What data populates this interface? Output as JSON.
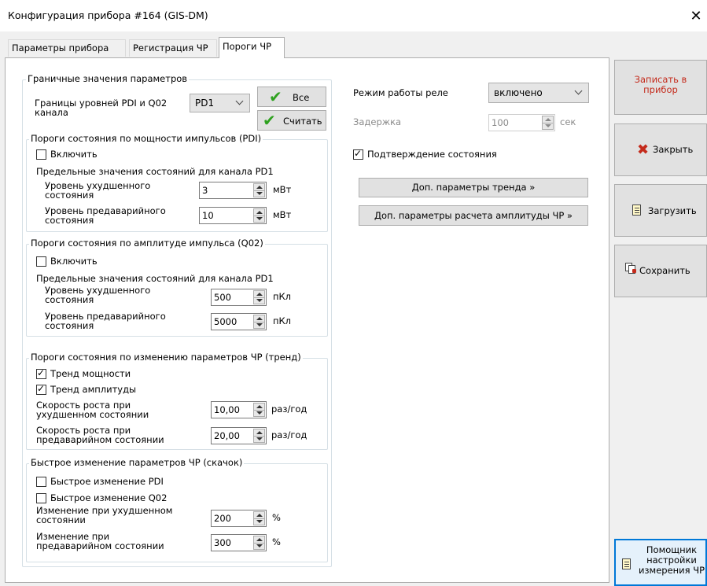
{
  "window": {
    "title": "Конфигурация прибора #164 (GIS-DM)"
  },
  "tabs": [
    {
      "label": "Параметры прибора"
    },
    {
      "label": "Регистрация ЧР"
    },
    {
      "label": "Пороги ЧР"
    }
  ],
  "limits": {
    "title": "Граничные значения параметров",
    "channel_label": "Границы уровней PDI и Q02 канала",
    "channel_value": "PD1",
    "all_button": "Все",
    "read_button": "Считать"
  },
  "pdi": {
    "title": "Пороги состояния по мощности импульсов (PDI)",
    "enable_label": "Включить",
    "enabled": false,
    "subtitle": "Предельные значения состояний для канала PD1",
    "rows": [
      {
        "label": "Уровень ухудшенного\nсостояния",
        "value": "3",
        "unit": "мВт"
      },
      {
        "label": "Уровень предаварийного\nсостояния",
        "value": "10",
        "unit": "мВт"
      }
    ]
  },
  "q02": {
    "title": "Пороги состояния по амплитуде импульса (Q02)",
    "enable_label": "Включить",
    "enabled": false,
    "subtitle": "Предельные значения состояний для канала PD1",
    "rows": [
      {
        "label": "Уровень ухудшенного\nсостояния",
        "value": "500",
        "unit": "пКл"
      },
      {
        "label": "Уровень предаварийного\nсостояния",
        "value": "5000",
        "unit": "пКл"
      }
    ]
  },
  "trend": {
    "title": "Пороги состояния по изменению параметров ЧР (тренд)",
    "power_label": "Тренд мощности",
    "power_checked": true,
    "amplitude_label": "Тренд амплитуды",
    "amplitude_checked": true,
    "rows": [
      {
        "label": "Скорость роста при\nухудшенном состоянии",
        "value": "10,00",
        "unit": "раз/год"
      },
      {
        "label": "Скорость роста при\nпредаварийном состоянии",
        "value": "20,00",
        "unit": "раз/год"
      }
    ]
  },
  "jump": {
    "title": "Быстрое изменение параметров ЧР (скачок)",
    "pdi_label": "Быстрое изменение PDI",
    "pdi_checked": false,
    "q02_label": "Быстрое изменение Q02",
    "q02_checked": false,
    "rows": [
      {
        "label": "Изменение при ухудшенном\nсостоянии",
        "value": "200",
        "unit": "%"
      },
      {
        "label": "Изменение при\nпредаварийном состоянии",
        "value": "300",
        "unit": "%"
      }
    ]
  },
  "relay": {
    "mode_label": "Режим работы реле",
    "mode_value": "включено",
    "delay_label": "Задержка",
    "delay_value": "100",
    "delay_unit": "сек",
    "confirm_label": "Подтверждение состояния",
    "confirm_checked": true,
    "trend_params_button": "Доп. параметры тренда »",
    "amp_params_button": "Доп. параметры расчета амплитуды ЧР »"
  },
  "sidebar": {
    "write": "Записать в прибор",
    "close": "Закрыть",
    "load": "Загрузить",
    "save": "Сохранить",
    "wizard": "Помощник настройки измерения ЧР"
  },
  "colors": {
    "write_text": "#c42b1c",
    "focus_border": "#0078d7",
    "check_green": "#2ea11f"
  }
}
